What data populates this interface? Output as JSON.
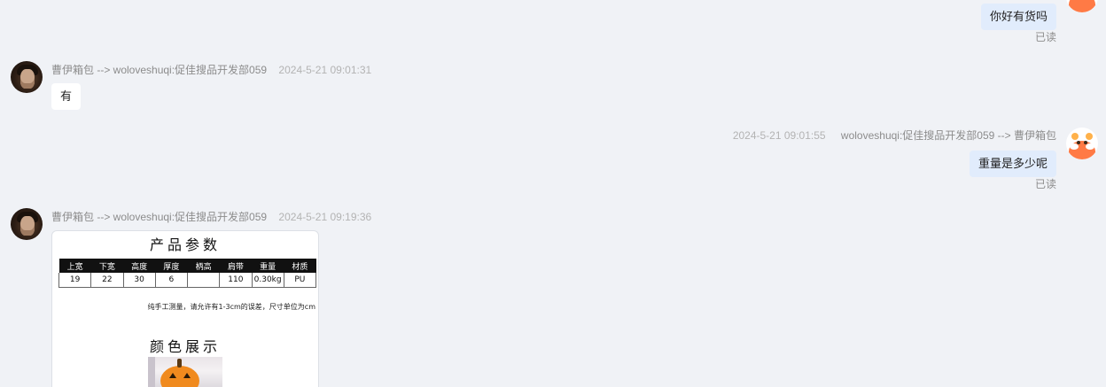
{
  "messages": [
    {
      "side": "right",
      "text": "你好有货吗",
      "read_label": "已读"
    },
    {
      "side": "left",
      "sender": "曹伊箱包 --> woloveshuqi:促佳搜品开发部059",
      "time": "2024-5-21 09:01:31",
      "text": "有"
    },
    {
      "side": "right",
      "time": "2024-5-21 09:01:55",
      "sender": "woloveshuqi:促佳搜品开发部059 --> 曹伊箱包",
      "text": "重量是多少呢",
      "read_label": "已读"
    },
    {
      "side": "left",
      "sender": "曹伊箱包 --> woloveshuqi:促佳搜品开发部059",
      "time": "2024-5-21 09:19:36",
      "image": {
        "title": "产品参数",
        "table_headers": [
          "上宽",
          "下宽",
          "高度",
          "厚度",
          "柄高",
          "肩带",
          "重量",
          "材质"
        ],
        "table_values": [
          "19",
          "22",
          "30",
          "6",
          "",
          "110",
          "0.30kg",
          "PU"
        ],
        "note": "纯手工测量，请允许有1-3cm的误差，尺寸单位为cm",
        "section_title": "颜色展示"
      }
    }
  ],
  "colors": {
    "background": "#f0f2f6",
    "bubble_right": "#e1ecfc",
    "bubble_left": "#ffffff",
    "meta_text": "#8c8c8c"
  },
  "icons": {
    "shop_avatar": "avatar-shop-icon",
    "self_avatar": "avatar-self-icon"
  }
}
